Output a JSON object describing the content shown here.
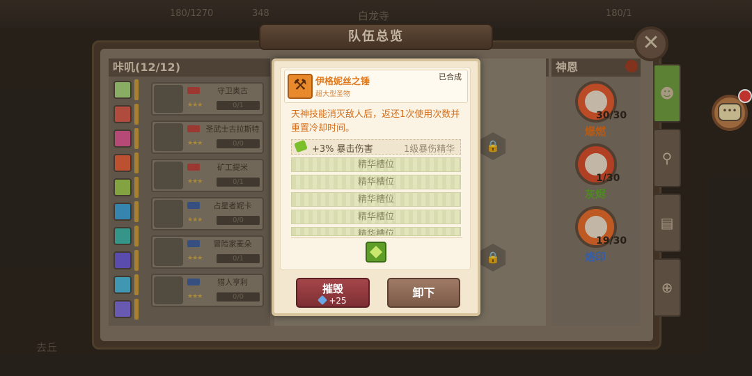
{
  "topbar": {
    "stamina": "180/1270",
    "gems": "348",
    "location": "白龙寺",
    "sub": "180/1"
  },
  "window": {
    "title": "队伍总览",
    "close_symbol": "✕"
  },
  "left_panel": {
    "header": "咔叽(12/12)",
    "heroes": [
      {
        "name": "守卫奥古",
        "stars": "★★★",
        "count": "0/1"
      },
      {
        "name": "圣武士古拉斯特",
        "stars": "★★★",
        "count": "0/0"
      },
      {
        "name": "矿工提米",
        "stars": "★★★",
        "count": "0/1"
      },
      {
        "name": "占星者妮卡",
        "stars": "★★★",
        "count": "0/0"
      },
      {
        "name": "冒险家麦朵",
        "stars": "★★★",
        "count": "0/1"
      },
      {
        "name": "猎人亨利",
        "stars": "★★★",
        "count": "0/0"
      }
    ],
    "rune_colors": [
      "#a4d07a",
      "#d15a4a",
      "#d8578e",
      "#e0603a",
      "#9bc24e",
      "#3e9fd2",
      "#3bb3a4",
      "#6a5ad0",
      "#4ab5d6",
      "#7a6bd6"
    ]
  },
  "right_panel": {
    "header": "神恩",
    "blessings": [
      {
        "count": "30/30",
        "name": "爆燃",
        "name_color": "#d96b1a",
        "ring": "#e0572c"
      },
      {
        "count": "1/30",
        "name": "灰烬",
        "name_color": "#59a628",
        "ring": "#d34a2a"
      },
      {
        "count": "19/30",
        "name": "烙印",
        "name_color": "#3b6fcf",
        "ring": "#e46a2a"
      }
    ]
  },
  "side_tabs": [
    "☻",
    "⚲",
    "▤",
    "⊕"
  ],
  "chat": {
    "icon": "•••"
  },
  "item_popup": {
    "name": "伊格妮丝之锤",
    "type": "超大型圣物",
    "status": "已合成",
    "icon": "⚒",
    "description": "天神技能消灭敌人后，返还1次使用次数并重置冷却时间。",
    "stat": {
      "text": "+3% 暴击伤害",
      "tag": "1级暴伤精华"
    },
    "slots": [
      "精华槽位",
      "精华槽位",
      "精华槽位",
      "精华槽位",
      "精华槽位"
    ],
    "destroy_button": {
      "label": "摧毁",
      "reward": "+25"
    },
    "unequip_button": {
      "label": "卸下"
    }
  },
  "bottom_text": "去丘"
}
